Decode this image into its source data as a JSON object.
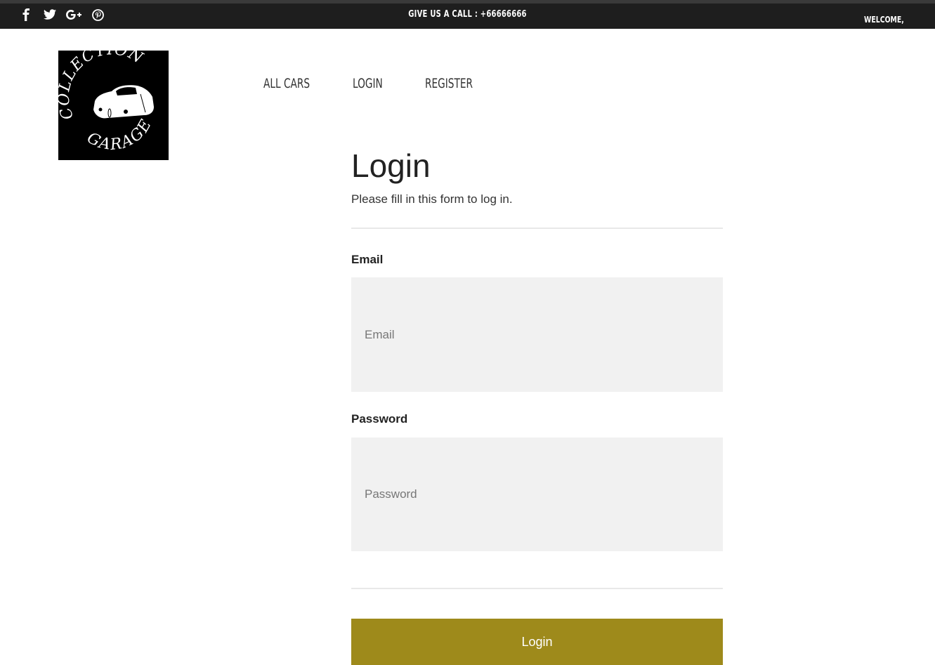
{
  "topbar": {
    "social": [
      {
        "icon": "facebook-icon"
      },
      {
        "icon": "twitter-icon"
      },
      {
        "icon": "google-plus-icon"
      },
      {
        "icon": "pinterest-icon"
      }
    ],
    "call_text": "GIVE US A CALL : +66666666",
    "welcome": "WELCOME,"
  },
  "logo": {
    "top_text": "COLLECTION",
    "bottom_text": "GARAGE"
  },
  "nav": {
    "items": [
      {
        "label": "ALL CARS"
      },
      {
        "label": "LOGIN"
      },
      {
        "label": "REGISTER"
      }
    ]
  },
  "form": {
    "title": "Login",
    "subtitle": "Please fill in this form to log in.",
    "email_label": "Email",
    "email_placeholder": "Email",
    "password_label": "Password",
    "password_placeholder": "Password",
    "submit_label": "Login"
  },
  "colors": {
    "topbar": "#1e1e1e",
    "button": "#9e8a1b",
    "field_bg": "#f1f1f1"
  }
}
